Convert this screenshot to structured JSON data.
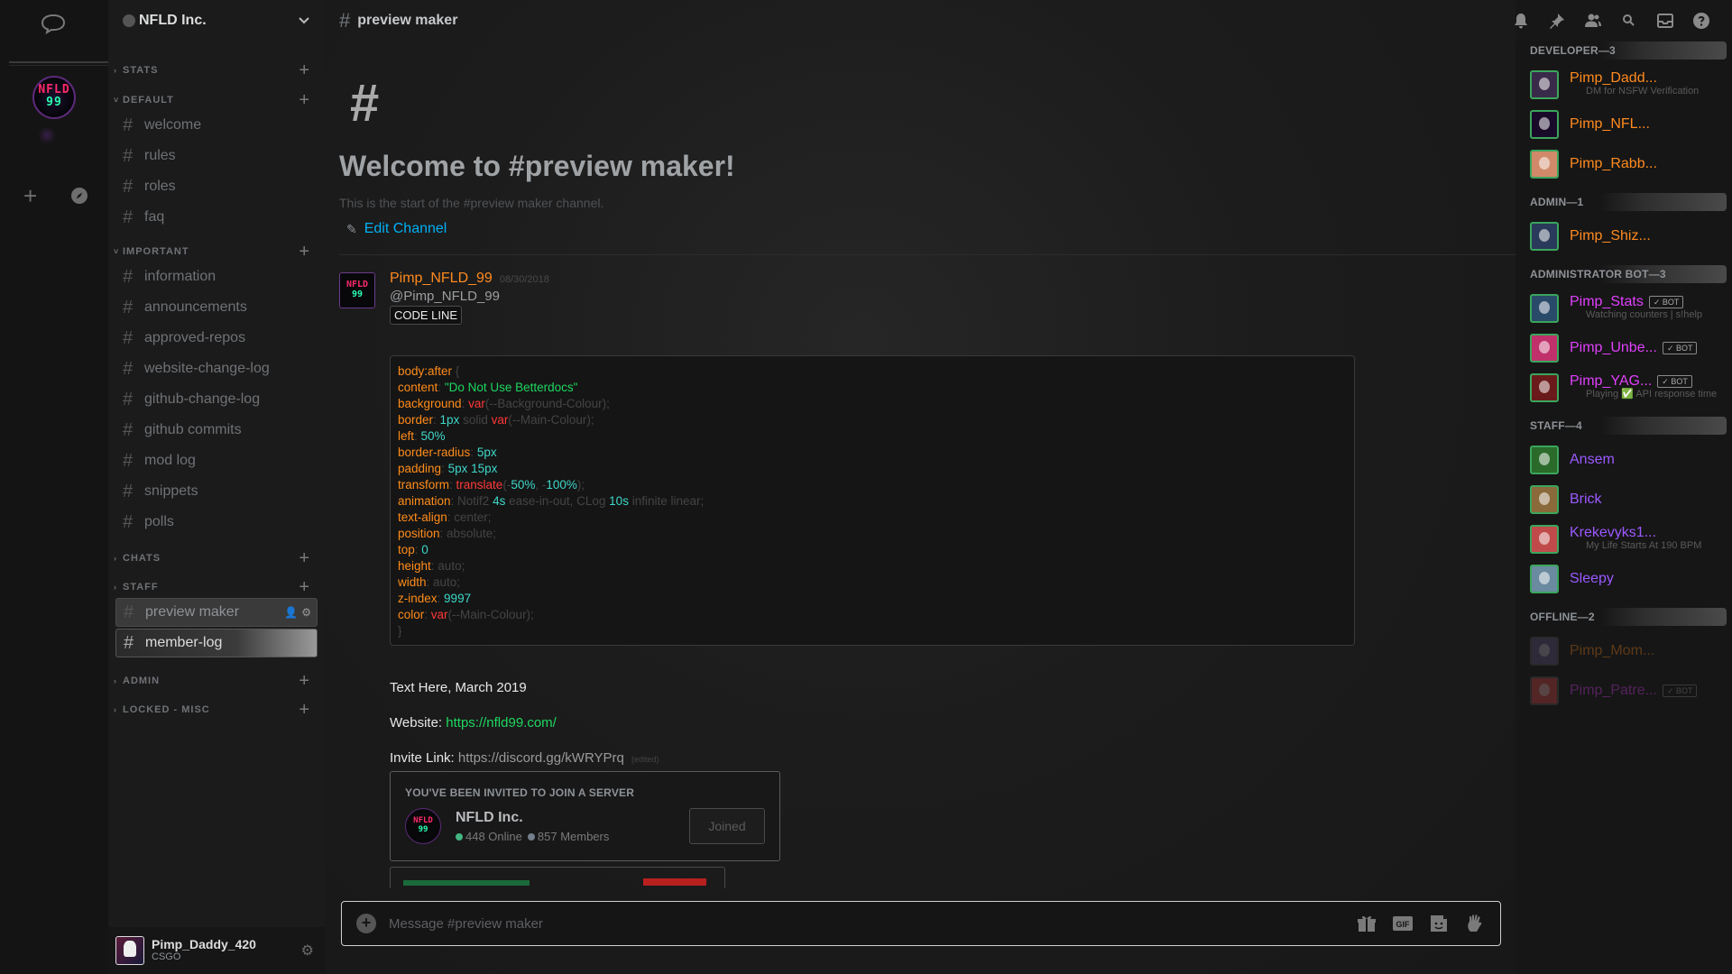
{
  "server_rail": {
    "server_text_lines": [
      "NFLD",
      "99"
    ],
    "add_label": "+"
  },
  "guild": {
    "name": "NFLD Inc."
  },
  "categories": {
    "stats": "STATS",
    "default": "DEFAULT",
    "important": "IMPORTANT",
    "chats": "CHATS",
    "staff": "STAFF",
    "admin": "ADMIN",
    "locked_misc": "LOCKED - MISC"
  },
  "channels": {
    "default": [
      "welcome",
      "rules",
      "roles",
      "faq"
    ],
    "important": [
      "information",
      "announcements",
      "approved-repos",
      "website-change-log",
      "github-change-log",
      "github commits",
      "mod log",
      "snippets",
      "polls"
    ],
    "staff": [
      "preview maker",
      "member-log"
    ]
  },
  "user": {
    "name": "Pimp_Daddy_420",
    "status": "CSGO"
  },
  "topbar": {
    "channel": "preview maker"
  },
  "welcome": {
    "hash": "#",
    "title": "Welcome to #preview maker!",
    "subtitle": "This is the start of the #preview maker channel.",
    "edit_label": "Edit Channel"
  },
  "message": {
    "author": "Pimp_NFLD_99",
    "date": "08/30/2018",
    "mention": "@Pimp_NFLD_99",
    "code_inline": "CODE LINE",
    "code_lines": [
      [
        [
          "k",
          "body"
        ],
        [
          "k",
          ":after"
        ],
        [
          "p",
          " {"
        ]
      ],
      [
        [
          "k",
          "content"
        ],
        [
          "p",
          ": "
        ],
        [
          "s",
          "\"Do Not Use Betterdocs\""
        ]
      ],
      [
        [
          "k",
          "background"
        ],
        [
          "p",
          ": "
        ],
        [
          "v",
          "var"
        ],
        [
          "p",
          "(--Background-Colour);"
        ]
      ],
      [
        [
          "k",
          "border"
        ],
        [
          "p",
          ": "
        ],
        [
          "n",
          "1px"
        ],
        [
          "p",
          " solid "
        ],
        [
          "v",
          "var"
        ],
        [
          "p",
          "(--Main-Colour);"
        ]
      ],
      [
        [
          "k",
          "left"
        ],
        [
          "p",
          ": "
        ],
        [
          "n",
          "50%"
        ]
      ],
      [
        [
          "k",
          "border-radius"
        ],
        [
          "p",
          ": "
        ],
        [
          "n",
          "5px"
        ]
      ],
      [
        [
          "k",
          "padding"
        ],
        [
          "p",
          ": "
        ],
        [
          "n",
          "5px 15px"
        ]
      ],
      [
        [
          "k",
          "transform"
        ],
        [
          "p",
          ": "
        ],
        [
          "v",
          "translate"
        ],
        [
          "p",
          "(-"
        ],
        [
          "n",
          "50%"
        ],
        [
          "p",
          ", -"
        ],
        [
          "n",
          "100%"
        ],
        [
          "p",
          ");"
        ]
      ],
      [
        [
          "k",
          "animation"
        ],
        [
          "p",
          ": Notif2 "
        ],
        [
          "n",
          "4s"
        ],
        [
          "p",
          " ease-in-out, CLog "
        ],
        [
          "n",
          "10s"
        ],
        [
          "p",
          " infinite linear;"
        ]
      ],
      [
        [
          "k",
          "text-align"
        ],
        [
          "p",
          ": center;"
        ]
      ],
      [
        [
          "k",
          "position"
        ],
        [
          "p",
          ": absolute;"
        ]
      ],
      [
        [
          "k",
          "top"
        ],
        [
          "p",
          ": "
        ],
        [
          "n",
          "0"
        ]
      ],
      [
        [
          "k",
          "height"
        ],
        [
          "p",
          ": auto;"
        ]
      ],
      [
        [
          "k",
          "width"
        ],
        [
          "p",
          ": auto;"
        ]
      ],
      [
        [
          "k",
          "z-index"
        ],
        [
          "p",
          ": "
        ],
        [
          "n",
          "9997"
        ]
      ],
      [
        [
          "k",
          "color"
        ],
        [
          "p",
          ": "
        ],
        [
          "v",
          "var"
        ],
        [
          "p",
          "(--Main-Colour);"
        ]
      ],
      [
        [
          "p",
          "}"
        ]
      ]
    ],
    "text_here": "Text Here, March 2019",
    "website_label": "Website:",
    "website_url": "https://nfld99.com/",
    "invite_label": "Invite Link:",
    "invite_url": "https://discord.gg/kWRYPrq",
    "edited": "(edited)",
    "invite_card": {
      "heading": "YOU'VE BEEN INVITED TO JOIN A SERVER",
      "server_name": "NFLD Inc.",
      "online": "448 Online",
      "members": "857 Members",
      "button": "Joined"
    }
  },
  "composer": {
    "placeholder": "Message #preview maker"
  },
  "member_groups": [
    {
      "heading": "DEVELOPER—3",
      "members": [
        {
          "name": "Pimp_Dadd...",
          "sub": "DM for NSFW Verification",
          "color": "#ff8a1e",
          "bot": false,
          "av": "#3a2a4a"
        },
        {
          "name": "Pimp_NFL...",
          "sub": "",
          "color": "#ff8a1e",
          "bot": false,
          "av": "#1a0a2a"
        },
        {
          "name": "Pimp_Rabb...",
          "sub": "",
          "color": "#ff8a1e",
          "bot": false,
          "av": "#d08a6a"
        }
      ]
    },
    {
      "heading": "ADMIN—1",
      "members": [
        {
          "name": "Pimp_Shiz...",
          "sub": "",
          "color": "#ff8a1e",
          "bot": false,
          "av": "#2a3a5a"
        }
      ]
    },
    {
      "heading": "ADMINISTRATOR BOT—3",
      "members": [
        {
          "name": "Pimp_Stats",
          "sub": "Watching counters | s!help",
          "color": "#e040fb",
          "bot": true,
          "av": "#2a4a6a"
        },
        {
          "name": "Pimp_Unbe...",
          "sub": "",
          "color": "#e040fb",
          "bot": true,
          "av": "#c0306a"
        },
        {
          "name": "Pimp_YAG...",
          "sub": "Playing ✅ API response time",
          "color": "#e040fb",
          "bot": true,
          "av": "#6a1a1a"
        }
      ]
    },
    {
      "heading": "STAFF—4",
      "members": [
        {
          "name": "Ansem",
          "sub": "",
          "color": "#9b59ff",
          "bot": false,
          "av": "#2a6a2a"
        },
        {
          "name": "Brick",
          "sub": "",
          "color": "#9b59ff",
          "bot": false,
          "av": "#8a6a3a"
        },
        {
          "name": "Krekevyks1...",
          "sub": "My Life Starts At 190 BPM",
          "color": "#9b59ff",
          "bot": false,
          "av": "#c04a4a"
        },
        {
          "name": "Sleepy",
          "sub": "",
          "color": "#9b59ff",
          "bot": false,
          "av": "#6a8aa0"
        }
      ]
    },
    {
      "heading": "OFFLINE—2",
      "offline": true,
      "members": [
        {
          "name": "Pimp_Mom...",
          "sub": "",
          "color": "#ff8a1e",
          "bot": false,
          "av": "#6a5a8a"
        },
        {
          "name": "Pimp_Patre...",
          "sub": "",
          "color": "#e040fb",
          "bot": true,
          "av": "#e04a4a"
        }
      ]
    }
  ],
  "labels": {
    "bot_tag": "✓ BOT"
  }
}
